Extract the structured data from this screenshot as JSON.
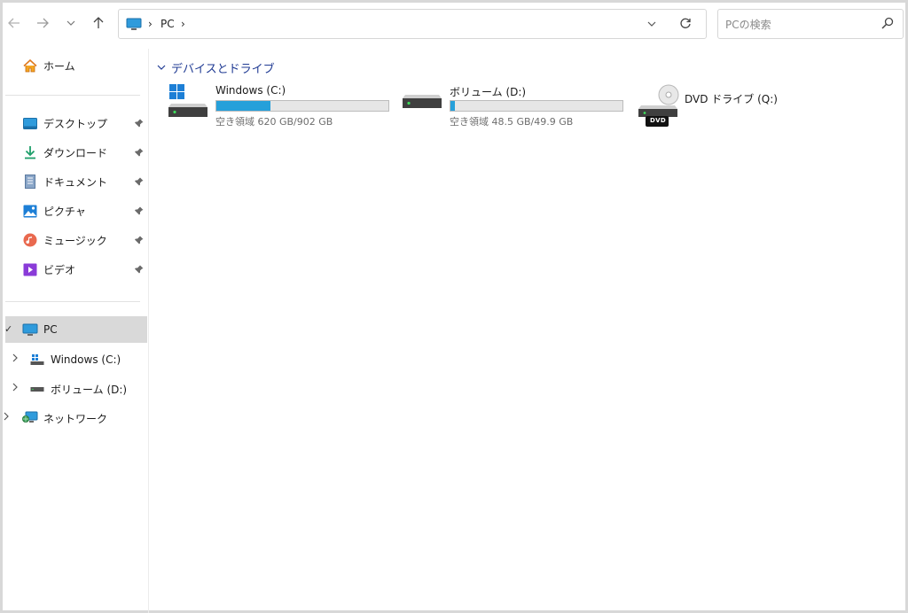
{
  "toolbar": {
    "back_icon": "back-arrow-icon",
    "forward_icon": "forward-arrow-icon",
    "recent_icon": "chevron-down-icon",
    "up_icon": "up-arrow-icon"
  },
  "address": {
    "breadcrumb": [
      "PC"
    ],
    "separator": "›",
    "refresh_icon": "refresh-icon"
  },
  "search": {
    "placeholder": "PCの検索",
    "value": ""
  },
  "sidebar": {
    "quick_access": {
      "label": "ホーム",
      "icon": "home-icon"
    },
    "pinned": [
      {
        "label": "デスクトップ",
        "icon": "desktop-icon"
      },
      {
        "label": "ダウンロード",
        "icon": "download-icon"
      },
      {
        "label": "ドキュメント",
        "icon": "document-icon"
      },
      {
        "label": "ピクチャ",
        "icon": "pictures-icon"
      },
      {
        "label": "ミュージック",
        "icon": "music-icon"
      },
      {
        "label": "ビデオ",
        "icon": "video-icon"
      }
    ],
    "tree": [
      {
        "label": "PC",
        "icon": "pc-icon",
        "selected": true
      },
      {
        "label": "Windows (C:)",
        "icon": "windows-drive-icon"
      },
      {
        "label": "ボリューム (D:)",
        "icon": "drive-icon"
      },
      {
        "label": "ネットワーク",
        "icon": "network-icon"
      }
    ],
    "selected_mark": "✓"
  },
  "main": {
    "group_title": "デバイスとドライブ",
    "drives": [
      {
        "name": "Windows (C:)",
        "free_text": "空き領域 620 GB/902 GB",
        "used_fraction": 0.313,
        "icon": "windows-drive-icon"
      },
      {
        "name": "ボリューム (D:)",
        "free_text": "空き領域 48.5 GB/49.9 GB",
        "used_fraction": 0.028,
        "icon": "drive-icon"
      },
      {
        "name": "DVD ドライブ (Q:)",
        "icon": "dvd-drive-icon",
        "badge": "DVD"
      }
    ]
  },
  "colors": {
    "accent": "#26a0da",
    "group_header": "#1f3a93",
    "selected_bg": "#d9d9d9"
  }
}
